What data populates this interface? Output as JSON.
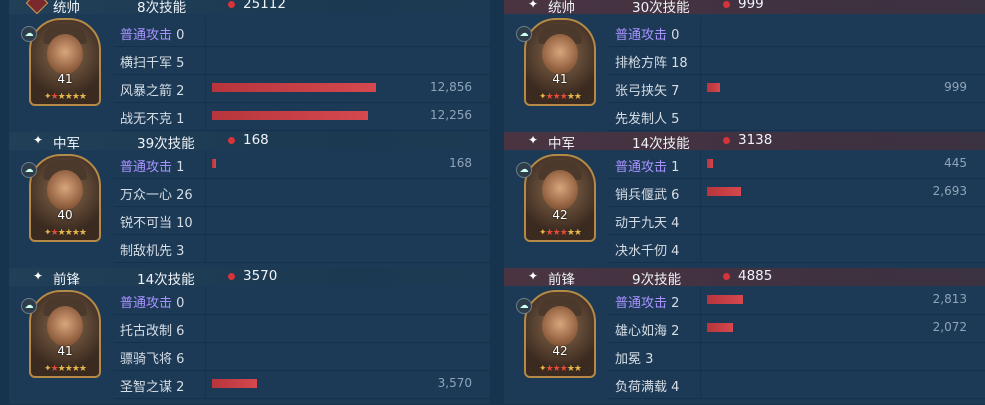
{
  "left": {
    "sections": [
      {
        "role": "统帅",
        "count": "8次技能",
        "total": "25112",
        "level": "41",
        "stars_red": 1,
        "skills": [
          {
            "name": "普通攻击",
            "num": "0",
            "type": "normal",
            "pct": 0,
            "value": ""
          },
          {
            "name": "横扫千军",
            "num": "5",
            "type": "skill",
            "pct": 0,
            "value": ""
          },
          {
            "name": "风暴之箭",
            "num": "2",
            "type": "skill",
            "pct": 0.512,
            "value": "12,856"
          },
          {
            "name": "战无不克",
            "num": "1",
            "type": "skill",
            "pct": 0.488,
            "value": "12,256"
          }
        ]
      },
      {
        "role": "中军",
        "count": "39次技能",
        "total": "168",
        "level": "40",
        "stars_red": 1,
        "skills": [
          {
            "name": "普通攻击",
            "num": "1",
            "type": "normal",
            "pct": 0.012,
            "value": "168"
          },
          {
            "name": "万众一心",
            "num": "26",
            "type": "skill",
            "pct": 0,
            "value": ""
          },
          {
            "name": "锐不可当",
            "num": "10",
            "type": "skill",
            "pct": 0,
            "value": ""
          },
          {
            "name": "制敌机先",
            "num": "3",
            "type": "skill",
            "pct": 0,
            "value": ""
          }
        ]
      },
      {
        "role": "前锋",
        "count": "14次技能",
        "total": "3570",
        "level": "41",
        "stars_red": 1,
        "skills": [
          {
            "name": "普通攻击",
            "num": "0",
            "type": "normal",
            "pct": 0,
            "value": ""
          },
          {
            "name": "托古改制",
            "num": "6",
            "type": "skill",
            "pct": 0,
            "value": ""
          },
          {
            "name": "骠骑飞将",
            "num": "6",
            "type": "skill",
            "pct": 0,
            "value": ""
          },
          {
            "name": "圣智之谋",
            "num": "2",
            "type": "skill",
            "pct": 0.142,
            "value": "3,570"
          }
        ]
      }
    ]
  },
  "right": {
    "sections": [
      {
        "role": "统帅",
        "count": "30次技能",
        "total": "999",
        "level": "41",
        "stars_red": 3,
        "skills": [
          {
            "name": "普通攻击",
            "num": "0",
            "type": "normal",
            "pct": 0,
            "value": ""
          },
          {
            "name": "排枪方阵",
            "num": "18",
            "type": "skill",
            "pct": 0,
            "value": ""
          },
          {
            "name": "张弓挟矢",
            "num": "7",
            "type": "skill",
            "pct": 0.04,
            "value": "999"
          },
          {
            "name": "先发制人",
            "num": "5",
            "type": "skill",
            "pct": 0,
            "value": ""
          }
        ]
      },
      {
        "role": "中军",
        "count": "14次技能",
        "total": "3138",
        "level": "42",
        "stars_red": 3,
        "skills": [
          {
            "name": "普通攻击",
            "num": "1",
            "type": "normal",
            "pct": 0.018,
            "value": "445"
          },
          {
            "name": "销兵偃武",
            "num": "6",
            "type": "skill",
            "pct": 0.107,
            "value": "2,693"
          },
          {
            "name": "动于九天",
            "num": "4",
            "type": "skill",
            "pct": 0,
            "value": ""
          },
          {
            "name": "决水千仞",
            "num": "4",
            "type": "skill",
            "pct": 0,
            "value": ""
          }
        ]
      },
      {
        "role": "前锋",
        "count": "9次技能",
        "total": "4885",
        "level": "42",
        "stars_red": 3,
        "skills": [
          {
            "name": "普通攻击",
            "num": "2",
            "type": "normal",
            "pct": 0.112,
            "value": "2,813"
          },
          {
            "name": "雄心如海",
            "num": "2",
            "type": "skill",
            "pct": 0.082,
            "value": "2,072"
          },
          {
            "name": "加冕",
            "num": "3",
            "type": "skill",
            "pct": 0,
            "value": ""
          },
          {
            "name": "负荷满载",
            "num": "4",
            "type": "skill",
            "pct": 0,
            "value": ""
          }
        ]
      }
    ]
  },
  "icons": {
    "header_star": "star-icon",
    "total_dot": "red-dot-icon",
    "badge": "unit-type-icon",
    "side_emblem": "commander-emblem-icon"
  },
  "colors": {
    "bar": "#d5484e",
    "normal_attack": "#a892ff",
    "left_header": "#223f58",
    "right_header": "#4a3442"
  }
}
